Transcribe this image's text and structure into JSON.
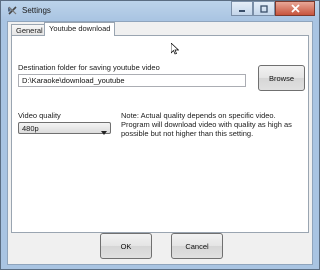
{
  "window": {
    "title": "Settings",
    "icons": {
      "app": "settings-wrench-icon",
      "minimize": "minimize-icon",
      "maximize": "maximize-icon",
      "close": "close-icon"
    }
  },
  "tabs": [
    {
      "label": "General",
      "active": false
    },
    {
      "label": "Youtube download",
      "active": true
    }
  ],
  "youtube": {
    "destination_label": "Destination folder for saving youtube video",
    "destination_value": "D:\\Karaoke\\download_youtube",
    "browse_label": "Browse",
    "quality_label": "Video quality",
    "quality_value": "480p",
    "note": "Note: Actual quality depends on specific video. Program will download video with quality as high as possible but not higher than this setting."
  },
  "footer": {
    "ok_label": "OK",
    "cancel_label": "Cancel"
  },
  "colors": {
    "accent": "#a9c4e2",
    "close": "#c7543d"
  }
}
